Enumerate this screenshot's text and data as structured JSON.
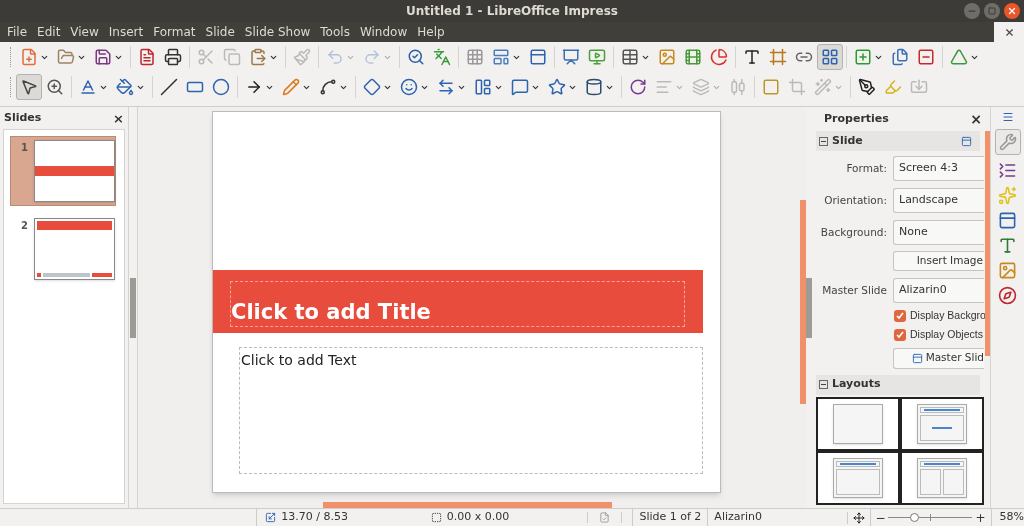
{
  "window": {
    "title": "Untitled 1 - LibreOffice Impress"
  },
  "menu": [
    "File",
    "Edit",
    "View",
    "Insert",
    "Format",
    "Slide",
    "Slide Show",
    "Tools",
    "Window",
    "Help"
  ],
  "toolbar_1": [
    {
      "kind": "new",
      "menu": true,
      "disabled": false,
      "pressed": false
    },
    {
      "kind": "open",
      "menu": true,
      "disabled": false,
      "pressed": false
    },
    {
      "kind": "save",
      "menu": true,
      "disabled": false,
      "pressed": false
    },
    {
      "kind": "separator"
    },
    {
      "kind": "pdf",
      "menu": false,
      "disabled": false,
      "pressed": false
    },
    {
      "kind": "print",
      "menu": false,
      "disabled": false,
      "pressed": false
    },
    {
      "kind": "separator"
    },
    {
      "kind": "cut",
      "menu": false,
      "disabled": true,
      "pressed": false
    },
    {
      "kind": "copy",
      "menu": false,
      "disabled": true,
      "pressed": false
    },
    {
      "kind": "paste",
      "menu": true,
      "disabled": false,
      "pressed": false
    },
    {
      "kind": "separator"
    },
    {
      "kind": "clone",
      "menu": false,
      "disabled": true,
      "pressed": false
    },
    {
      "kind": "separator"
    },
    {
      "kind": "undo",
      "menu": true,
      "disabled": true,
      "pressed": false
    },
    {
      "kind": "redo",
      "menu": true,
      "disabled": true,
      "pressed": false
    },
    {
      "kind": "separator"
    },
    {
      "kind": "find",
      "menu": false,
      "disabled": false,
      "pressed": false
    },
    {
      "kind": "spelling",
      "menu": false,
      "disabled": false,
      "pressed": false
    },
    {
      "kind": "separator"
    },
    {
      "kind": "grid",
      "menu": false,
      "disabled": false,
      "pressed": false
    },
    {
      "kind": "views",
      "menu": true,
      "disabled": false,
      "pressed": false
    },
    {
      "kind": "master",
      "menu": false,
      "disabled": false,
      "pressed": false
    },
    {
      "kind": "separator"
    },
    {
      "kind": "show-first",
      "menu": false,
      "disabled": false,
      "pressed": false
    },
    {
      "kind": "show-current",
      "menu": false,
      "disabled": false,
      "pressed": false
    },
    {
      "kind": "separator"
    },
    {
      "kind": "table",
      "menu": true,
      "disabled": false,
      "pressed": false
    },
    {
      "kind": "image",
      "menu": false,
      "disabled": false,
      "pressed": false
    },
    {
      "kind": "media",
      "menu": false,
      "disabled": false,
      "pressed": false
    },
    {
      "kind": "chart",
      "menu": false,
      "disabled": false,
      "pressed": false
    },
    {
      "kind": "separator"
    },
    {
      "kind": "textbox",
      "menu": false,
      "disabled": false,
      "pressed": false
    },
    {
      "kind": "fontwork",
      "menu": false,
      "disabled": false,
      "pressed": false
    },
    {
      "kind": "link",
      "menu": false,
      "disabled": false,
      "pressed": false
    },
    {
      "kind": "toggle-views",
      "menu": false,
      "disabled": false,
      "pressed": true
    },
    {
      "kind": "separator"
    },
    {
      "kind": "new-slide",
      "menu": true,
      "disabled": false,
      "pressed": false
    },
    {
      "kind": "duplicate-slide",
      "menu": false,
      "disabled": false,
      "pressed": false
    },
    {
      "kind": "delete-slide",
      "menu": false,
      "disabled": false,
      "pressed": false
    },
    {
      "kind": "separator"
    },
    {
      "kind": "slide-layout",
      "menu": true,
      "disabled": false,
      "pressed": false
    }
  ],
  "toolbar_2": [
    {
      "kind": "select",
      "menu": false,
      "disabled": false,
      "pressed": true
    },
    {
      "kind": "zoom",
      "menu": false,
      "disabled": false,
      "pressed": false
    },
    {
      "kind": "separator"
    },
    {
      "kind": "line-color",
      "menu": true,
      "disabled": false,
      "pressed": false
    },
    {
      "kind": "fill-color",
      "menu": true,
      "disabled": false,
      "pressed": false
    },
    {
      "kind": "separator"
    },
    {
      "kind": "line",
      "menu": false,
      "disabled": false,
      "pressed": false
    },
    {
      "kind": "rectangle",
      "menu": false,
      "disabled": false,
      "pressed": false
    },
    {
      "kind": "ellipse",
      "menu": false,
      "disabled": false,
      "pressed": false
    },
    {
      "kind": "separator"
    },
    {
      "kind": "arrow",
      "menu": true,
      "disabled": false,
      "pressed": false
    },
    {
      "kind": "pencil",
      "menu": true,
      "disabled": false,
      "pressed": false
    },
    {
      "kind": "connector",
      "menu": true,
      "disabled": false,
      "pressed": false
    },
    {
      "kind": "separator"
    },
    {
      "kind": "diamond",
      "menu": true,
      "disabled": false,
      "pressed": false
    },
    {
      "kind": "smiley",
      "menu": true,
      "disabled": false,
      "pressed": false
    },
    {
      "kind": "double-arrow",
      "menu": true,
      "disabled": false,
      "pressed": false
    },
    {
      "kind": "flowchart",
      "menu": true,
      "disabled": false,
      "pressed": false
    },
    {
      "kind": "callout",
      "menu": true,
      "disabled": false,
      "pressed": false
    },
    {
      "kind": "star",
      "menu": true,
      "disabled": false,
      "pressed": false
    },
    {
      "kind": "cylinder",
      "menu": true,
      "disabled": false,
      "pressed": false
    },
    {
      "kind": "separator"
    },
    {
      "kind": "rotate",
      "menu": false,
      "disabled": false,
      "pressed": false
    },
    {
      "kind": "align",
      "menu": true,
      "disabled": true,
      "pressed": false
    },
    {
      "kind": "arrange",
      "menu": true,
      "disabled": true,
      "pressed": false
    },
    {
      "kind": "distribute",
      "menu": false,
      "disabled": true,
      "pressed": false
    },
    {
      "kind": "separator"
    },
    {
      "kind": "shadow",
      "menu": false,
      "disabled": false,
      "pressed": false
    },
    {
      "kind": "crop",
      "menu": false,
      "disabled": true,
      "pressed": false
    },
    {
      "kind": "filter",
      "menu": true,
      "disabled": true,
      "pressed": false
    },
    {
      "kind": "separator"
    },
    {
      "kind": "points",
      "menu": false,
      "disabled": false,
      "pressed": false
    },
    {
      "kind": "glue",
      "menu": false,
      "disabled": false,
      "pressed": false
    },
    {
      "kind": "extrusion",
      "menu": false,
      "disabled": true,
      "pressed": false
    }
  ],
  "slides_pane": {
    "title": "Slides",
    "close": "×",
    "slides": [
      {
        "number": "1",
        "kind": "title",
        "selected": true
      },
      {
        "number": "2",
        "kind": "content",
        "selected": false
      }
    ]
  },
  "slide": {
    "title_placeholder": "Click to add Title",
    "body_placeholder": "Click to add Text"
  },
  "properties": {
    "title": "Properties",
    "close": "×",
    "slide_section": {
      "title": "Slide",
      "expanded": true,
      "fields": [
        {
          "label": "Format:",
          "value": "Screen 4:3"
        },
        {
          "label": "Orientation:",
          "value": "Landscape"
        },
        {
          "label": "Background:",
          "value": "None"
        }
      ],
      "insert_image": "Insert Image",
      "master_slide": {
        "label": "Master Slide",
        "value": "Alizarin0"
      },
      "checkboxes": [
        {
          "label": "Display Backgro",
          "checked": true
        },
        {
          "label": "Display Objects",
          "checked": true
        }
      ],
      "master_button": "Master Slid"
    },
    "layouts_section": {
      "title": "Layouts",
      "expanded": true,
      "layouts": [
        {
          "kind": "blank"
        },
        {
          "kind": "title-content"
        },
        {
          "kind": "title-box"
        },
        {
          "kind": "title-two-columns"
        }
      ]
    }
  },
  "status_bar": {
    "position": "13.70 / 8.53",
    "size": "0.00 x 0.00",
    "slide": "Slide 1 of 2",
    "master": "Alizarin0",
    "zoom_minus": "−",
    "zoom_plus": "+",
    "zoom": {
      "level": 0.3
    },
    "zoom_percent": "58%"
  }
}
